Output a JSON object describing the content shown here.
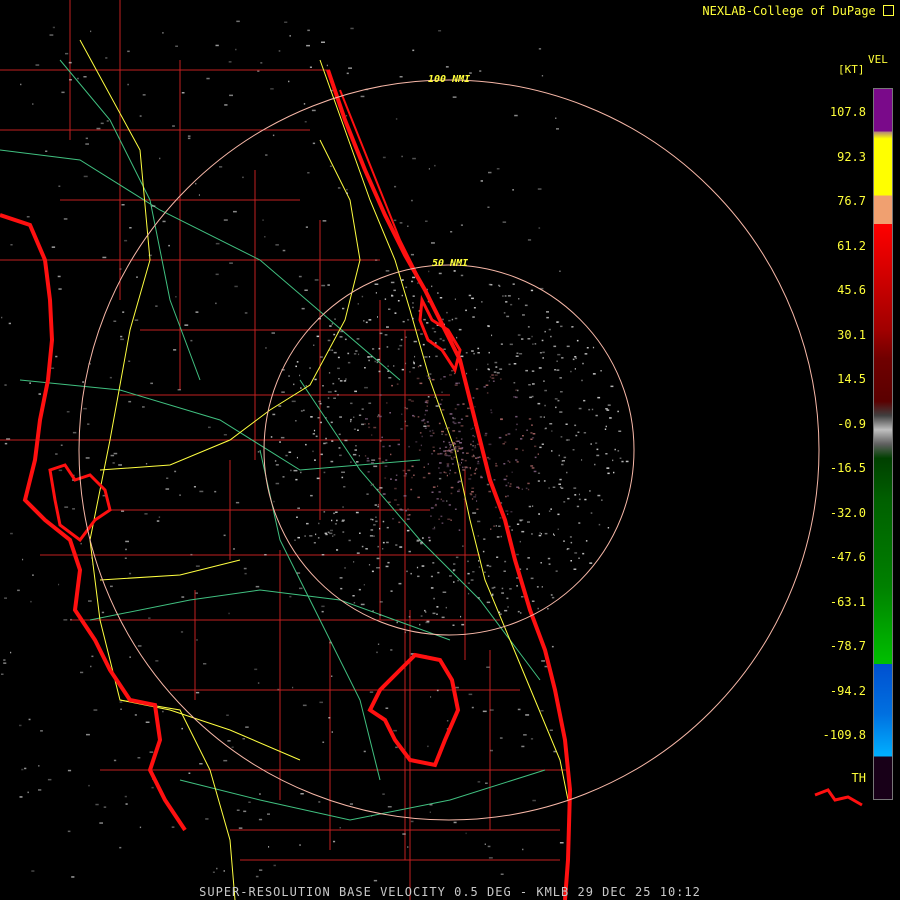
{
  "credit": "NEXLAB-College of DuPage",
  "footer": "SUPER-RESOLUTION BASE VELOCITY 0.5 DEG - KMLB 29 DEC 25 10:12",
  "product": {
    "code": "VEL",
    "unit": "[KT]"
  },
  "range_rings": [
    {
      "label": "100 NMI"
    },
    {
      "label": "50 NMI"
    }
  ],
  "legend": {
    "labels": [
      "107.8",
      "92.3",
      "76.7",
      "61.2",
      "45.6",
      "30.1",
      "14.5",
      "-0.9",
      "-16.5",
      "-32.0",
      "-47.6",
      "-63.1",
      "-78.7",
      "-94.2",
      "-109.8"
    ],
    "th_label": "TH",
    "colors": {
      "purple": "#7a0a8a",
      "yellow": "#ffff00",
      "peach": "#f0a070",
      "red": "#ff0000",
      "dark_red": "#5a0000",
      "gray": "#c0c0c0",
      "green": "#00c000",
      "dark_green": "#004000",
      "blue": "#0050d0",
      "cyan": "#00b0ff",
      "dark": "#180018"
    }
  },
  "map_colors": {
    "coast": "#ff1010",
    "county": "#c02020",
    "highway": "#ffff40",
    "road": "#40c080",
    "ring": "#f8b8a8",
    "echo": "#d0d0d0"
  }
}
